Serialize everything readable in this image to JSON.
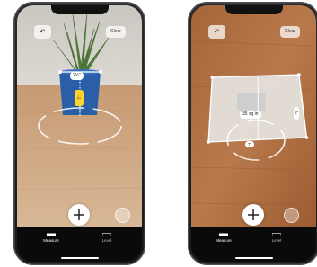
{
  "left_phone": {
    "undo_icon": "undo-arrow-icon",
    "clear_label": "Clear",
    "horizontal_measurement": "2½\"",
    "vertical_measurement": "5\"",
    "add_point_icon": "plus-icon",
    "capture_icon": "shutter-icon",
    "tabs": [
      {
        "label": "Measure",
        "icon": "measure-icon",
        "active": true
      },
      {
        "label": "Level",
        "icon": "level-icon",
        "active": false
      }
    ]
  },
  "right_phone": {
    "undo_icon": "undo-arrow-icon",
    "clear_label": "Clear",
    "area_measurement": "35 sq in",
    "width_measurement": "7\"",
    "height_measurement": "5\"",
    "add_point_icon": "plus-icon",
    "capture_icon": "shutter-icon",
    "tabs": [
      {
        "label": "Measure",
        "icon": "measure-icon",
        "active": true
      },
      {
        "label": "Level",
        "icon": "level-icon",
        "active": false
      }
    ]
  },
  "colors": {
    "measure_line": "#ffffff",
    "vertical_label": "#ffd42a",
    "table_wood": "#a86a3e",
    "wall": "#d9d3c8",
    "bottom_bar": "#0a0a0a"
  }
}
